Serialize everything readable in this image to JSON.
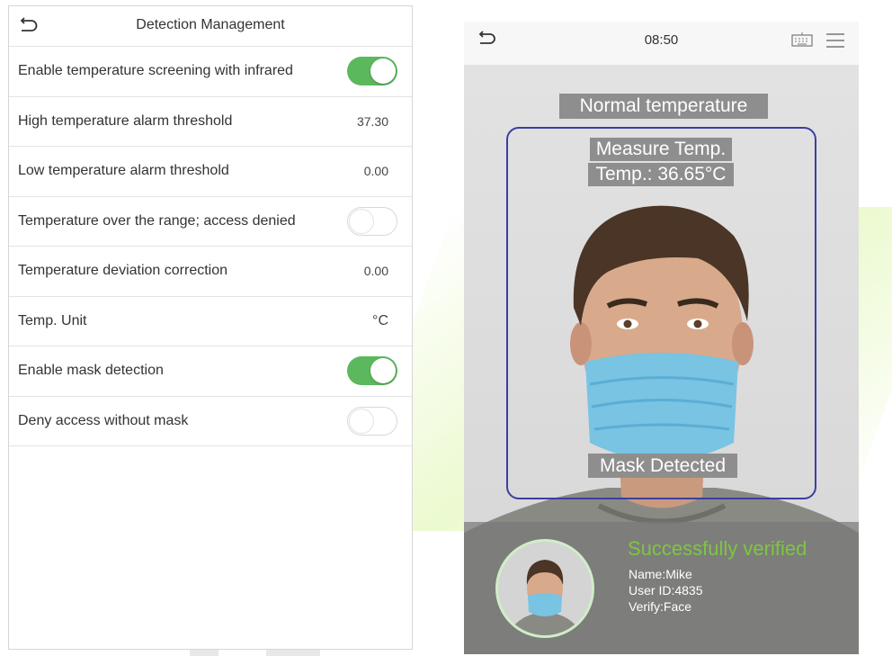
{
  "left_panel": {
    "title": "Detection Management",
    "rows": [
      {
        "label": "Enable temperature screening with infrared",
        "type": "toggle",
        "on": true
      },
      {
        "label": "High temperature alarm threshold",
        "type": "value",
        "value": "37.30"
      },
      {
        "label": "Low temperature alarm threshold",
        "type": "value",
        "value": "0.00"
      },
      {
        "label": "Temperature over the range; access denied",
        "type": "toggle",
        "on": false
      },
      {
        "label": "Temperature deviation correction",
        "type": "value",
        "value": "0.00"
      },
      {
        "label": "Temp. Unit",
        "type": "value",
        "value": "°C"
      },
      {
        "label": "Enable mask detection",
        "type": "toggle",
        "on": true
      },
      {
        "label": "Deny access without mask",
        "type": "toggle",
        "on": false
      }
    ]
  },
  "device": {
    "time": "08:50",
    "temp_banner": "Normal temperature",
    "measure_label": "Measure Temp.",
    "temp_label": "Temp.: 36.65°C",
    "mask_label": "Mask Detected",
    "success_text": "Successfully verified",
    "name_line": "Name:Mike",
    "user_id_line": "User ID:4835",
    "verify_line": "Verify:Face"
  },
  "colors": {
    "toggle_on": "#5bb85d",
    "frame_border": "#3b3fa0",
    "success": "#7ec63f"
  },
  "icons": [
    "back-arrow-icon",
    "keyboard-icon",
    "menu-icon"
  ]
}
